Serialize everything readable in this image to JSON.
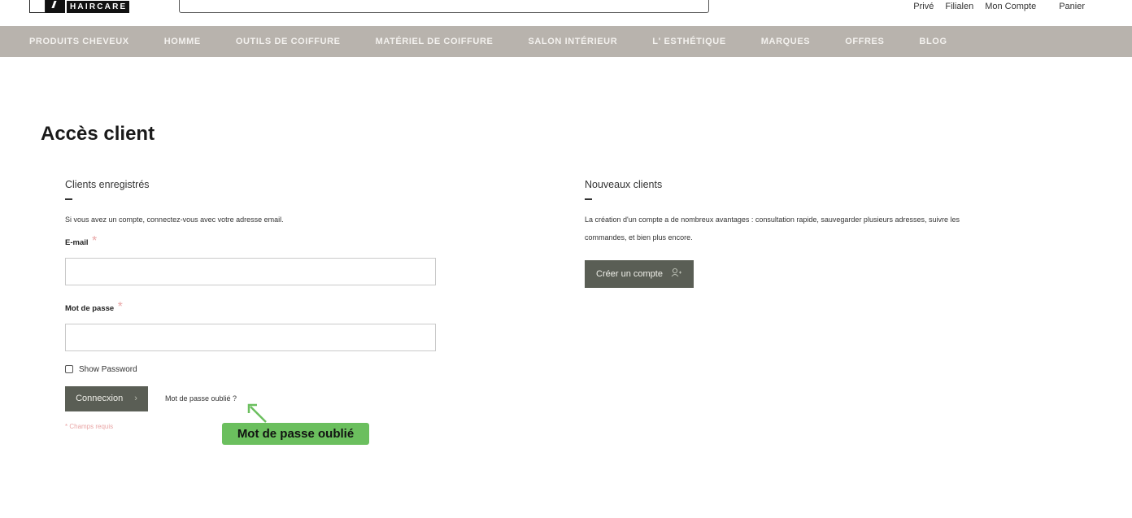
{
  "header": {
    "logo_text": "HAIRCARE",
    "search": {
      "value": "",
      "placeholder": ""
    },
    "links": [
      "Privé",
      "Filialen",
      "Mon Compte",
      "Panier"
    ]
  },
  "nav": {
    "items": [
      "PRODUITS CHEVEUX",
      "HOMME",
      "OUTILS DE COIFFURE",
      "MATÉRIEL DE COIFFURE",
      "SALON INTÉRIEUR",
      "L' ESTHÉTIQUE",
      "MARQUES",
      "OFFRES",
      "BLOG"
    ]
  },
  "page": {
    "title": "Accès client"
  },
  "registered": {
    "title": "Clients enregistrés",
    "description": "Si vous avez un compte, connectez-vous avec votre adresse email.",
    "email_label": "E-mail",
    "email_value": "",
    "password_label": "Mot de passe",
    "password_value": "",
    "required_marker": "*",
    "show_password_label": "Show Password",
    "login_button": "Connecxion",
    "forgot_link": "Mot de passe oublié ?",
    "required_note": "* Champs requis"
  },
  "new_clients": {
    "title": "Nouveaux clients",
    "description_line1": "La création d'un compte a de nombreux avantages : consultation rapide, sauvegarder plusieurs adresses, suivre les",
    "description_line2": "commandes, et bien plus encore.",
    "create_button": "Créer un compte"
  },
  "annotation": {
    "label": "Mot de passe oublié",
    "color": "#6bbf5e"
  },
  "colors": {
    "nav_bg": "#b8b3ad",
    "button_bg": "#5a5e55",
    "required": "#e9a6a6"
  }
}
